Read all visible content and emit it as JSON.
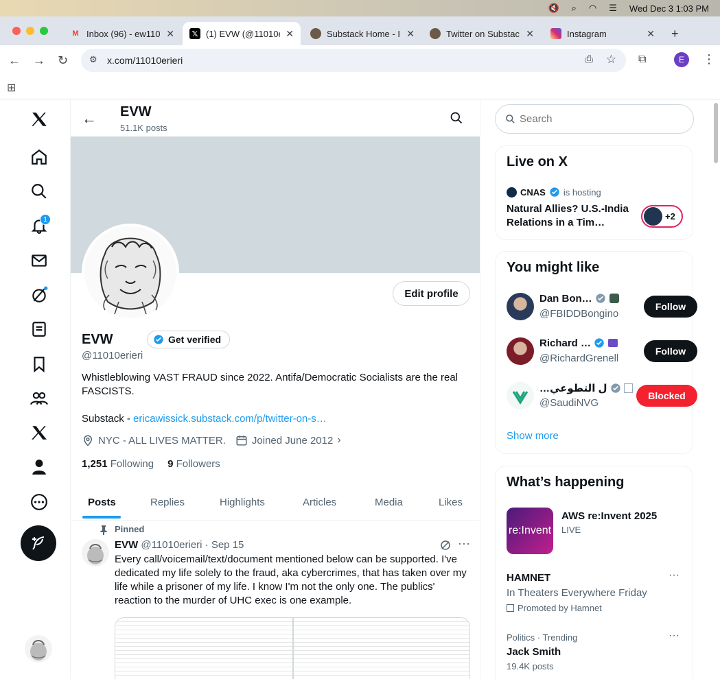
{
  "os_bar": {
    "datetime": "Wed Dec 3  1:03 PM"
  },
  "browser": {
    "tabs": [
      {
        "title": "Inbox (96) - ew110",
        "icon": "gmail-icon",
        "active": false
      },
      {
        "title": "(1) EVW (@11010e",
        "icon": "x-logo-icon",
        "active": true
      },
      {
        "title": "Substack Home - I",
        "icon": "substack-icon",
        "active": false
      },
      {
        "title": "Twitter on Substac",
        "icon": "substack-icon",
        "active": false
      },
      {
        "title": "Instagram",
        "icon": "instagram-icon",
        "active": false
      }
    ],
    "new_tab": "+",
    "url": "x.com/11010erieri",
    "profile_initial": "E"
  },
  "sidebar": {
    "notification_badge": "1"
  },
  "header": {
    "name": "EVW",
    "posts_count": "51.1K posts"
  },
  "profile": {
    "edit_button": "Edit profile",
    "name": "EVW",
    "get_verified": "Get verified",
    "handle": "@11010erieri",
    "bio_line1": "Whistleblowing VAST FRAUD since 2022. Antifa/Democratic Socialists are the real FASCISTS.",
    "bio_substack_label": "Substack - ",
    "bio_link": "ericawissick.substack.com/p/twitter-on-s…",
    "location": "NYC - ALL LIVES MATTER.",
    "joined": "Joined June 2012",
    "following_count": "1,251",
    "following_label": "Following",
    "followers_count": "9",
    "followers_label": "Followers"
  },
  "profile_tabs": [
    "Posts",
    "Replies",
    "Highlights",
    "Articles",
    "Media",
    "Likes"
  ],
  "pinned_post": {
    "pinned_label": "Pinned",
    "author": "EVW",
    "handle_date": "@11010erieri · Sep 15",
    "text": "Every call/voicemail/text/document mentioned below can be supported. I've dedicated my life solely to the fraud, aka cybercrimes, that has taken over my life while a prisoner of my life. I know I'm not the only one. The publics' reaction to the murder of UHC exec is one example."
  },
  "search": {
    "placeholder": "Search"
  },
  "live": {
    "title": "Live on X",
    "host": "CNAS",
    "host_suffix": "is hosting",
    "event_title": "Natural Allies? U.S.-India Relations in a Tim…",
    "extra_count": "+2"
  },
  "suggestions": {
    "title": "You might like",
    "items": [
      {
        "name": "Dan Bon…",
        "handle": "@FBIDDBongino",
        "button": "Follow"
      },
      {
        "name": "Richard …",
        "handle": "@RichardGrenell",
        "button": "Follow"
      },
      {
        "name": "…ل التطوعي",
        "handle": "@SaudiNVG",
        "button": "Blocked"
      }
    ],
    "show_more": "Show more"
  },
  "happening": {
    "title": "What’s happening",
    "event": {
      "title": "AWS re:Invent 2025",
      "status": "LIVE",
      "thumb_text": "re:Invent"
    },
    "promoted": {
      "title": "HAMNET",
      "subtitle": "In Theaters Everywhere Friday",
      "promoted_by": "Promoted by Hamnet"
    },
    "trend": {
      "category": "Politics · Trending",
      "title": "Jack Smith",
      "posts": "19.4K posts"
    }
  },
  "colors": {
    "accent": "#1d9bf0",
    "blocked": "#f4212e",
    "text": "#0f1419",
    "muted": "#536471"
  }
}
